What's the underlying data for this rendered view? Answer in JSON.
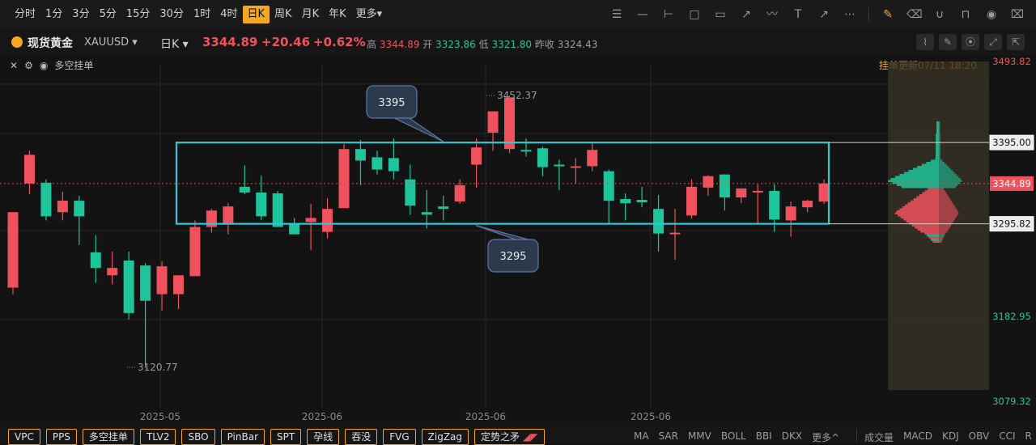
{
  "toolbar": {
    "timeframes": [
      "分时",
      "1分",
      "3分",
      "5分",
      "15分",
      "30分",
      "1时",
      "4时",
      "日K",
      "周K",
      "月K",
      "年K",
      "更多▾"
    ],
    "active_index": 8,
    "tool_icons": [
      "bars-icon",
      "hline-icon",
      "ray-icon",
      "rect-icon",
      "callout-icon",
      "arrow-line-icon",
      "wave-icon",
      "text-icon",
      "arrow-icon",
      "more-icon",
      "edit-icon",
      "eraser-icon",
      "magnet-icon",
      "lock-icon",
      "eye-icon",
      "trash-icon"
    ]
  },
  "info": {
    "symbol": "现货黄金",
    "code": "XAUUSD ▾",
    "period": "日K ▾",
    "price": "3344.89",
    "change": "+20.46",
    "change_pct": "+0.62%",
    "high_label": "高",
    "high": "3344.89",
    "open_label": "开",
    "open": "3323.86",
    "low_label": "低",
    "low": "3321.80",
    "prev_label": "昨收",
    "prev": "3324.43"
  },
  "subbar": {
    "label": "多空挂单",
    "update": "挂单更新07/11 18:20"
  },
  "colors": {
    "up": "#f0525d",
    "down": "#1ec59b",
    "box": "#2fc7d6",
    "accent": "#f5a623"
  },
  "chart_data": {
    "type": "candlestick",
    "price_axis": {
      "ticks": [
        "3493.82",
        "3395.00",
        "3344.89",
        "3295.82",
        "3182.95",
        "3079.32"
      ],
      "range": [
        3079.32,
        3493.82
      ]
    },
    "date_labels": [
      "2025-05",
      "2025-06",
      "2025-06",
      "2025-06"
    ],
    "candles": [
      {
        "o": 3218,
        "h": 3260,
        "l": 3210,
        "c": 3310
      },
      {
        "o": 3345,
        "h": 3385,
        "l": 3332,
        "c": 3380
      },
      {
        "o": 3346,
        "h": 3350,
        "l": 3300,
        "c": 3305
      },
      {
        "o": 3310,
        "h": 3335,
        "l": 3300,
        "c": 3324
      },
      {
        "o": 3324,
        "h": 3330,
        "l": 3270,
        "c": 3305
      },
      {
        "o": 3261,
        "h": 3282,
        "l": 3224,
        "c": 3242
      },
      {
        "o": 3233,
        "h": 3262,
        "l": 3222,
        "c": 3242
      },
      {
        "o": 3251,
        "h": 3262,
        "l": 3179,
        "c": 3187
      },
      {
        "o": 3245,
        "h": 3248,
        "l": 3120,
        "c": 3202
      },
      {
        "o": 3210,
        "h": 3250,
        "l": 3190,
        "c": 3244
      },
      {
        "o": 3210,
        "h": 3228,
        "l": 3192,
        "c": 3233
      },
      {
        "o": 3232,
        "h": 3300,
        "l": 3232,
        "c": 3292
      },
      {
        "o": 3292,
        "h": 3314,
        "l": 3285,
        "c": 3312
      },
      {
        "o": 3297,
        "h": 3321,
        "l": 3283,
        "c": 3317
      },
      {
        "o": 3341,
        "h": 3367,
        "l": 3332,
        "c": 3334
      },
      {
        "o": 3334,
        "h": 3355,
        "l": 3300,
        "c": 3305
      },
      {
        "o": 3333,
        "h": 3336,
        "l": 3293,
        "c": 3292
      },
      {
        "o": 3296,
        "h": 3303,
        "l": 3285,
        "c": 3283
      },
      {
        "o": 3298,
        "h": 3320,
        "l": 3264,
        "c": 3303
      },
      {
        "o": 3286,
        "h": 3327,
        "l": 3278,
        "c": 3314
      },
      {
        "o": 3315,
        "h": 3393,
        "l": 3315,
        "c": 3387
      },
      {
        "o": 3387,
        "h": 3398,
        "l": 3343,
        "c": 3373
      },
      {
        "o": 3377,
        "h": 3385,
        "l": 3356,
        "c": 3362
      },
      {
        "o": 3376,
        "h": 3400,
        "l": 3350,
        "c": 3360
      },
      {
        "o": 3350,
        "h": 3368,
        "l": 3307,
        "c": 3318
      },
      {
        "o": 3310,
        "h": 3337,
        "l": 3290,
        "c": 3307
      },
      {
        "o": 3317,
        "h": 3330,
        "l": 3300,
        "c": 3314
      },
      {
        "o": 3323,
        "h": 3350,
        "l": 3320,
        "c": 3343
      },
      {
        "o": 3368,
        "h": 3400,
        "l": 3340,
        "c": 3389
      },
      {
        "o": 3407,
        "h": 3430,
        "l": 3385,
        "c": 3433
      },
      {
        "o": 3387,
        "h": 3452,
        "l": 3382,
        "c": 3450
      },
      {
        "o": 3386,
        "h": 3400,
        "l": 3378,
        "c": 3384
      },
      {
        "o": 3388,
        "h": 3390,
        "l": 3354,
        "c": 3365
      },
      {
        "o": 3368,
        "h": 3374,
        "l": 3337,
        "c": 3366
      },
      {
        "o": 3366,
        "h": 3376,
        "l": 3345,
        "c": 3366
      },
      {
        "o": 3366,
        "h": 3394,
        "l": 3360,
        "c": 3386
      },
      {
        "o": 3360,
        "h": 3362,
        "l": 3296,
        "c": 3324
      },
      {
        "o": 3326,
        "h": 3333,
        "l": 3300,
        "c": 3321
      },
      {
        "o": 3325,
        "h": 3341,
        "l": 3316,
        "c": 3322
      },
      {
        "o": 3314,
        "h": 3331,
        "l": 3262,
        "c": 3284
      },
      {
        "o": 3284,
        "h": 3314,
        "l": 3252,
        "c": 3285
      },
      {
        "o": 3306,
        "h": 3350,
        "l": 3302,
        "c": 3341
      },
      {
        "o": 3340,
        "h": 3355,
        "l": 3330,
        "c": 3354
      },
      {
        "o": 3356,
        "h": 3356,
        "l": 3312,
        "c": 3328
      },
      {
        "o": 3328,
        "h": 3339,
        "l": 3321,
        "c": 3339
      },
      {
        "o": 3335,
        "h": 3344,
        "l": 3295,
        "c": 3336
      },
      {
        "o": 3336,
        "h": 3344,
        "l": 3286,
        "c": 3301
      },
      {
        "o": 3300,
        "h": 3323,
        "l": 3280,
        "c": 3317
      },
      {
        "o": 3316,
        "h": 3325,
        "l": 3310,
        "c": 3324
      },
      {
        "o": 3323,
        "h": 3350,
        "l": 3320,
        "c": 3345
      }
    ],
    "annotations": {
      "high_label": "3452.37",
      "low_label": "3120.77",
      "box_top_callout": "3395",
      "box_bottom_callout": "3295",
      "box_top": 3395.0,
      "box_bottom": 3295.82
    }
  },
  "bottom": {
    "buttons": [
      "VPC",
      "PPS",
      "多空挂单",
      "TLV2",
      "SBO",
      "PinBar",
      "SPT",
      "孕线",
      "吞没",
      "FVG",
      "ZigZag",
      "定势之矛"
    ],
    "indicators": [
      "MA",
      "SAR",
      "MMV",
      "BOLL",
      "BBI",
      "DKX",
      "更多^"
    ],
    "indicators2": [
      "成交量",
      "MACD",
      "KDJ",
      "OBV",
      "CCI",
      "R"
    ]
  }
}
